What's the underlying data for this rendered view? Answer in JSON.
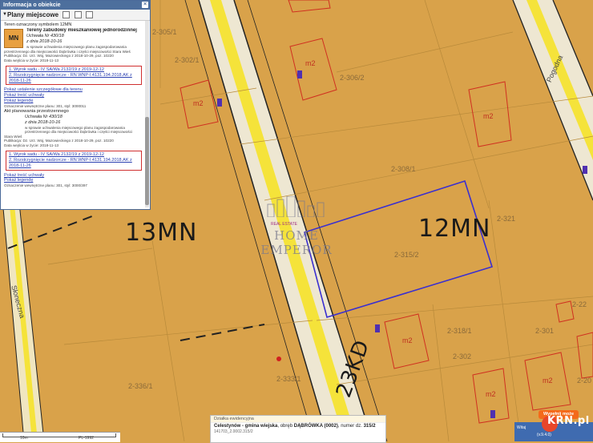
{
  "panel": {
    "title": "Informacja o obiekcie",
    "tab_title": "Plany miejscowe",
    "intro": "Teren oznaczony symbolem 12MN",
    "symbol": "MN",
    "use_title": "Tereny zabudowy mieszkaniowej jednorodzinnej",
    "resolution": "Uchwała Nr 430/18",
    "resolution_date": "z dnia 2018-10-16",
    "resolution_desc": "w sprawie uchwalenia miejscowego planu zagospodarowania przestrzennego dla miejscowości Dąbrówka i części miejscowości Stara Wieś",
    "publication": "Publikacja: Dz. Urz. Woj. Mazowieckiego z 2018-10-29, poz. 10220",
    "effective": "Data wejścia w życie: 2018-11-13",
    "links": [
      "1. Wyrok sadu - IV SA/Wa 2132/19 z 2019-12-12",
      "2. Rozstrzygnięcie nadzorcze - RN WNP-I.4131.194.2018.AK z 2018-11-26"
    ],
    "show_detail": "Pokaż ustalenie szczegółowe dla terenu",
    "show_text": "Pokaż treść uchwały",
    "show_legend": "Pokaż legendę",
    "plan_number": "Oznaczenie wewnętrzne planu: 301, styl: 3000011",
    "act_title": "Akt planowania przestrzennego",
    "plan_number2": "Oznaczenie wewnętrzne planu: 301, styl: 3000/397"
  },
  "map": {
    "zone_13": "13MN",
    "zone_12": "12MN",
    "road": "23KD",
    "watermark_small": "REAL ESTATE",
    "watermark": "HOME EMPEROR",
    "building_label": "m2",
    "parcels": [
      "2-305/1",
      "2-306/2",
      "2-308/1",
      "2-315/2",
      "2-321",
      "2-318/1",
      "2-333/1",
      "2-302/1",
      "2-336/1",
      "2-301",
      "2-302",
      "2-22",
      "2-20"
    ],
    "street_left": "Słoneczna",
    "street_right": "Pogodna"
  },
  "scalebar": {
    "left": "10m",
    "right": "PL-1992"
  },
  "parcel_info": {
    "header": "Działka ewidencyjna",
    "line_prefix": "Celestynów - gmina wiejska",
    "obreb_label": "obręb",
    "obreb": "DĄBRÓWKA (0002)",
    "numer_label": "numer dz.",
    "numer": "315/2",
    "id": "141703_2.0002.315/2"
  },
  "cta": {
    "fill": "Wypełnij może",
    "welcome": "Witaj",
    "version": "(v.9.4.0)",
    "logo": "KRN.pl"
  }
}
